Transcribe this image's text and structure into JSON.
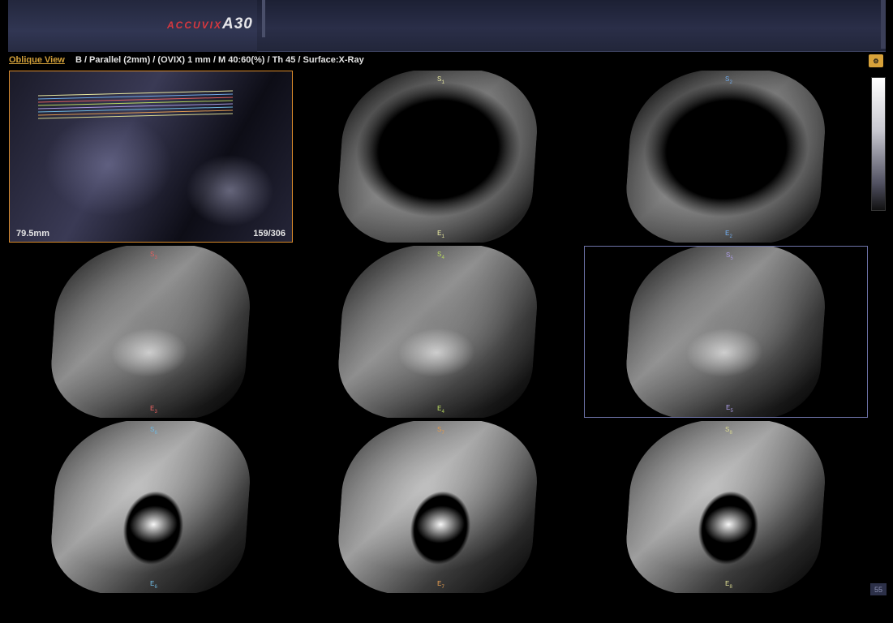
{
  "header": {
    "brand": "ACCUVIX",
    "model": "A30"
  },
  "infobar": {
    "view_name": "Oblique View",
    "params": "B / Parallel (2mm) / (OVIX) 1 mm / M 40:60(%) / Th 45 / Surface:X-Ray"
  },
  "reference_panel": {
    "depth": "79.5mm",
    "frame": "159/306"
  },
  "slices": [
    {
      "start": "S",
      "start_sub": "1",
      "end": "E",
      "end_sub": "1",
      "color": "#e8e8a0"
    },
    {
      "start": "S",
      "start_sub": "2",
      "end": "E",
      "end_sub": "2",
      "color": "#6fa8e8"
    },
    {
      "start": "S",
      "start_sub": "3",
      "end": "E",
      "end_sub": "3",
      "color": "#e06060"
    },
    {
      "start": "S",
      "start_sub": "4",
      "end": "E",
      "end_sub": "4",
      "color": "#b8d860"
    },
    {
      "start": "S",
      "start_sub": "5",
      "end": "E",
      "end_sub": "5",
      "color": "#a89ae0"
    },
    {
      "start": "S",
      "start_sub": "6",
      "end": "E",
      "end_sub": "6",
      "color": "#6fb8e0"
    },
    {
      "start": "S",
      "start_sub": "7",
      "end": "E",
      "end_sub": "7",
      "color": "#e09a50"
    },
    {
      "start": "S",
      "start_sub": "8",
      "end": "E",
      "end_sub": "8",
      "color": "#d8d890"
    }
  ],
  "page_number": "55",
  "icons": {
    "corner": "settings-icon"
  }
}
